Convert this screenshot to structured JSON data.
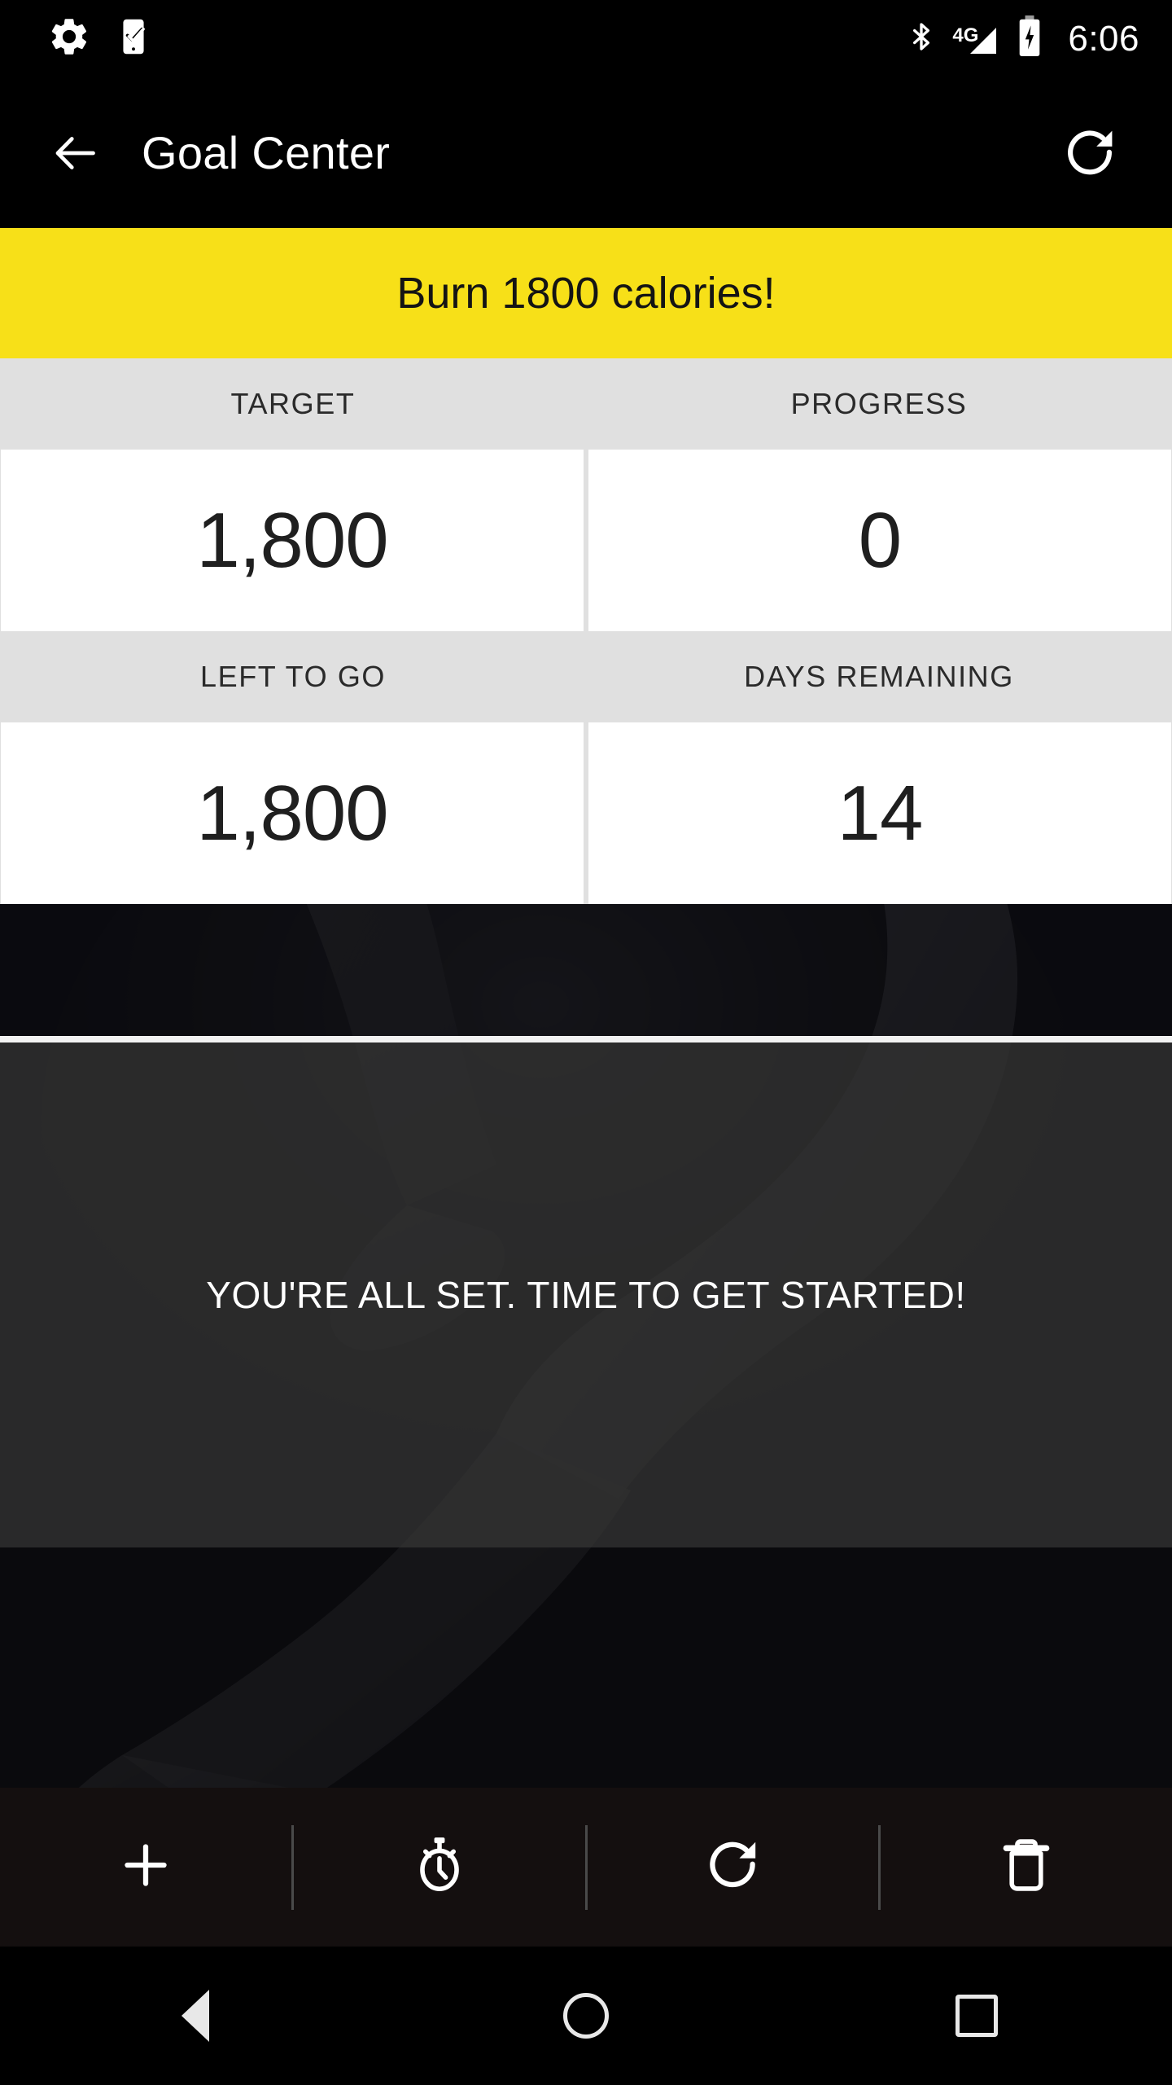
{
  "status_bar": {
    "icons_left": [
      "gear-icon",
      "phone-check-icon"
    ],
    "bluetooth_icon": "bluetooth-icon",
    "network_label": "4G",
    "signal_icon": "signal-bars-icon",
    "battery_icon": "battery-charging-icon",
    "time": "6:06"
  },
  "app_bar": {
    "back_icon": "back-arrow-icon",
    "title": "Goal Center",
    "refresh_icon": "refresh-icon"
  },
  "banner": {
    "text": "Burn 1800 calories!",
    "background_color": "#F7E018",
    "text_color": "#141414"
  },
  "stats": {
    "header_background": "#E0E0E0",
    "value_background": "#FFFFFF",
    "rows": [
      {
        "cells": [
          {
            "label": "TARGET",
            "value": "1,800"
          },
          {
            "label": "PROGRESS",
            "value": "0"
          }
        ]
      },
      {
        "cells": [
          {
            "label": "LEFT TO GO",
            "value": "1,800"
          },
          {
            "label": "DAYS REMAINING",
            "value": "14"
          }
        ]
      }
    ]
  },
  "hero": {
    "message": "YOU'RE ALL SET. TIME TO GET STARTED!",
    "background_image": "runner-silhouette-photo"
  },
  "toolbar": {
    "items": [
      {
        "name": "add-button",
        "icon": "plus-icon"
      },
      {
        "name": "timer-button",
        "icon": "stopwatch-icon"
      },
      {
        "name": "reset-button",
        "icon": "refresh-icon"
      },
      {
        "name": "delete-button",
        "icon": "trash-icon"
      }
    ]
  },
  "nav_bar": {
    "back": "nav-back-icon",
    "home": "nav-home-icon",
    "recents": "nav-recents-icon"
  }
}
